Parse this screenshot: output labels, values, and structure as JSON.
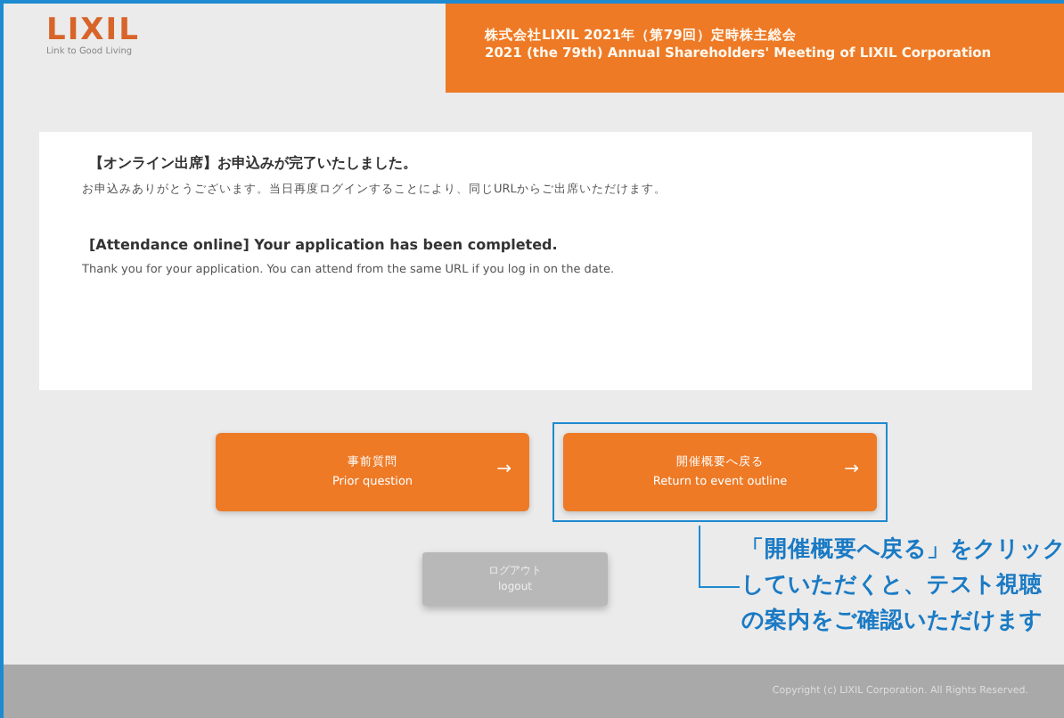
{
  "header": {
    "logo": "LIXIL",
    "tagline": "Link to Good Living",
    "title_ja": "株式会社LIXIL 2021年（第79回）定時株主総会",
    "title_en": "2021 (the 79th) Annual Shareholders' Meeting of LIXIL Corporation"
  },
  "notice": [
    {
      "heading": "【オンライン出席】お申込みが完了いたしました。",
      "body": "お申込みありがとうございます。当日再度ログインすることにより、同じURLからご出席いただけます。"
    },
    {
      "heading": "[Attendance online] Your application has been completed.",
      "body": "Thank you for your application. You can attend from the same URL if you log in on the date."
    }
  ],
  "buttons": [
    {
      "label_ja": "事前質問",
      "label_en": "Prior question",
      "arrow": "→",
      "highlighted": false
    },
    {
      "label_ja": "開催概要へ戻る",
      "label_en": "Return to event outline",
      "arrow": "→",
      "highlighted": true
    }
  ],
  "logout": {
    "label_ja": "ログアウト",
    "label_en": "logout"
  },
  "annotation": [
    "「開催概要へ戻る」をクリック",
    "していただくと、テスト視聴",
    "の案内をご確認いただけます"
  ],
  "footer": "Copyright (c) LIXIL Corporation. All Rights Reserved."
}
